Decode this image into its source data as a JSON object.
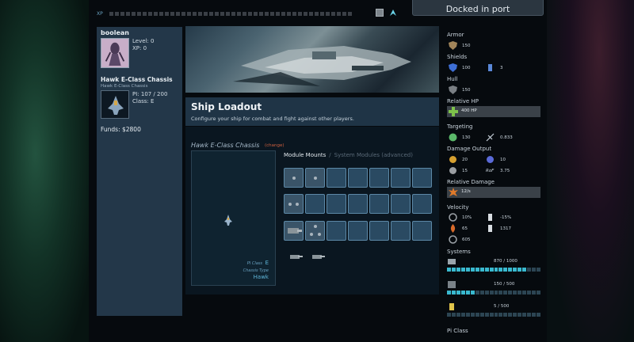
{
  "xp_bar": {
    "label": "XP",
    "segments": 44
  },
  "status": {
    "docked": "Docked in port"
  },
  "pilot": {
    "name": "boolean",
    "level_label": "Level: 0",
    "xp_label": "XP: 0"
  },
  "chassis": {
    "title": "Hawk E-Class Chassis",
    "subtitle": "Hawk E-Class Chassis",
    "pi_label": "PI: 107 / 200",
    "class_label": "Class: E"
  },
  "funds": "Funds: $2800",
  "loadout": {
    "title": "Ship Loadout",
    "description": "Configure your ship for combat and fight against other players.",
    "chassis_name": "Hawk E-Class Chassis",
    "change_label": "(change)",
    "pi_class_label": "PI Class",
    "pi_class_value": "E",
    "chassis_type_label": "Chassis Type",
    "chassis_type_value": "Hawk",
    "tab_active": "Module Mounts",
    "tab_separator": "/",
    "tab_inactive": "System Modules (advanced)"
  },
  "stats": {
    "armor_label": "Armor",
    "armor_value": "150",
    "shields_label": "Shields",
    "shields_value": "100",
    "shields_secondary": "3",
    "hull_label": "Hull",
    "hull_value": "150",
    "relative_hp_label": "Relative HP",
    "relative_hp_value": "400 HP",
    "targeting_label": "Targeting",
    "targeting_value": "130",
    "targeting_secondary": "0.833",
    "damage_output_label": "Damage Output",
    "dmg_a": "20",
    "dmg_b": "10",
    "dmg_c": "15",
    "rof_label": "RoF",
    "rof_value": "3.75",
    "relative_damage_label": "Relative Damage",
    "relative_damage_value": "12/s",
    "velocity_label": "Velocity",
    "vel_a": "10%",
    "vel_b": "-15%",
    "vel_c": "65",
    "vel_d": "1317",
    "vel_e": "605",
    "systems_label": "Systems",
    "sys1_value": "870 / 1000",
    "sys1_fill": 0.87,
    "sys2_value": "150 / 500",
    "sys2_fill": 0.3,
    "sys3_value": "5 / 500",
    "sys3_fill": 0.01,
    "pi_class_label": "Pi Class"
  },
  "colors": {
    "panel": "#233749",
    "accent": "#39b9cf",
    "slot": "#2a4a62",
    "change": "#d0603e"
  }
}
